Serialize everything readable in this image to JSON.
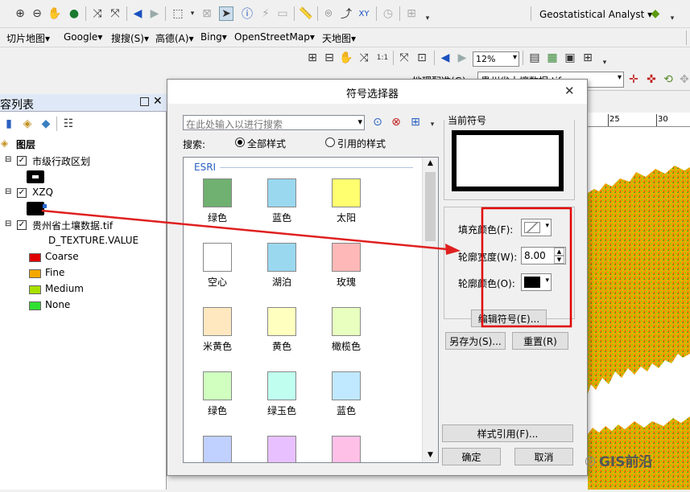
{
  "toolbar1": {
    "geostat_label": "Geostatistical Analyst ▾"
  },
  "menubar": {
    "items": [
      "切片地图▾",
      "Google▾",
      "搜搜(S)▾",
      "高德(A)▾",
      "Bing▾",
      "OpenStreetMap▾",
      "天地图▾"
    ]
  },
  "toolbar3": {
    "zoom_value": "12%"
  },
  "map_toolbar": {
    "georef_label": "地理配准(G)▾",
    "layer_select": "贵州省土壤数据.tif"
  },
  "toc": {
    "title": "容列表",
    "root": "图层",
    "layers": [
      {
        "name": "市级行政区划"
      },
      {
        "name": "XZQ"
      },
      {
        "name": "贵州省土壤数据.tif",
        "field": "D_TEXTURE.VALUE"
      }
    ],
    "legend": [
      {
        "label": "Coarse",
        "color": "#e00000"
      },
      {
        "label": "Fine",
        "color": "#f5a800"
      },
      {
        "label": "Medium",
        "color": "#a8e000"
      },
      {
        "label": "None",
        "color": "#30e030"
      }
    ]
  },
  "dialog": {
    "title": "符号选择器",
    "search_placeholder": "在此处输入以进行搜索",
    "search_label": "搜索:",
    "radio_all": "全部样式",
    "radio_ref": "引用的样式",
    "group_label": "ESRI",
    "symbols": [
      {
        "label": "绿色",
        "color": "#70b070"
      },
      {
        "label": "蓝色",
        "color": "#9ad8f0"
      },
      {
        "label": "太阳",
        "color": "#ffff70"
      },
      {
        "label": "空心",
        "color": "#ffffff"
      },
      {
        "label": "湖泊",
        "color": "#9ad8f0"
      },
      {
        "label": "玫瑰",
        "color": "#ffb8b8"
      },
      {
        "label": "米黄色",
        "color": "#ffe8c0"
      },
      {
        "label": "黄色",
        "color": "#ffffc0"
      },
      {
        "label": "橄榄色",
        "color": "#e8ffc0"
      },
      {
        "label": "绿色",
        "color": "#d0ffc0"
      },
      {
        "label": "绿玉色",
        "color": "#c0fff0"
      },
      {
        "label": "蓝色",
        "color": "#c0e8ff"
      },
      {
        "label": "",
        "color": "#c0d0ff"
      },
      {
        "label": "",
        "color": "#e8c0ff"
      },
      {
        "label": "",
        "color": "#ffc0e8"
      }
    ],
    "current_symbol_label": "当前符号",
    "fill_color_label": "填充颜色(F):",
    "outline_width_label": "轮廓宽度(W):",
    "outline_width_value": "8.00",
    "outline_color_label": "轮廓颜色(O):",
    "edit_symbol_btn": "编辑符号(E)...",
    "save_as_btn": "另存为(S)...",
    "reset_btn": "重置(R)",
    "style_ref_btn": "样式引用(F)...",
    "ok_btn": "确定",
    "cancel_btn": "取消"
  },
  "map": {
    "ruler_ticks": [
      "25",
      "30"
    ]
  },
  "watermark": "GIS前沿",
  "colors": {
    "highlight_red": "#e00000",
    "arrow_red": "#e02020"
  }
}
